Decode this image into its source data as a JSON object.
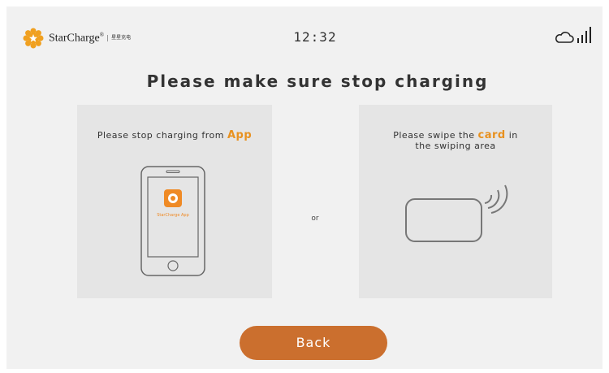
{
  "header": {
    "brand_name": "StarCharge",
    "brand_tm": "®",
    "brand_sub": "星星充电",
    "time": "12:32",
    "cloud_icon": "cloud-icon",
    "signal_icon": "signal-bars-icon"
  },
  "title": "Please make sure stop charging",
  "left_panel": {
    "text_prefix": "Please stop charging from ",
    "text_highlight": "App",
    "phone_icon": "phone-icon",
    "app_icon_label": "StarCharge App"
  },
  "separator": "or",
  "right_panel": {
    "line1_prefix": "Please swipe the ",
    "line1_highlight": "card",
    "line1_suffix": " in",
    "line2": "the swiping area",
    "card_icon": "card-swipe-icon"
  },
  "back_button": "Back",
  "colors": {
    "accent": "#e8911f",
    "button": "#cb6f2e",
    "panel": "#e5e5e5",
    "background": "#f1f1f1"
  }
}
